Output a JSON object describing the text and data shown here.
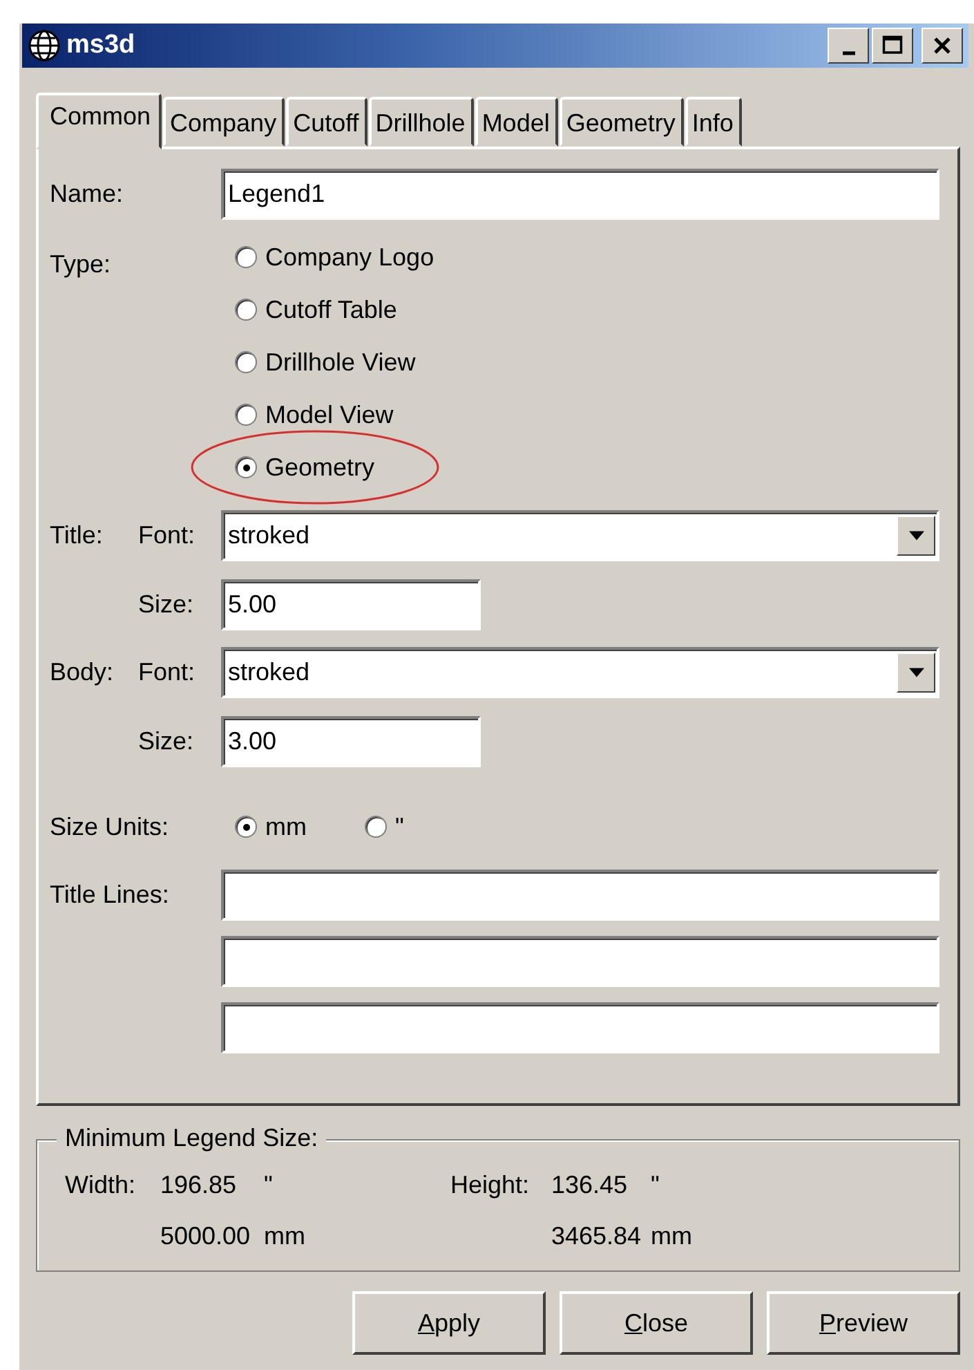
{
  "window": {
    "title": "ms3d"
  },
  "tabs": [
    {
      "label": "Common",
      "selected": true
    },
    {
      "label": "Company",
      "selected": false
    },
    {
      "label": "Cutoff",
      "selected": false
    },
    {
      "label": "Drillhole",
      "selected": false
    },
    {
      "label": "Model",
      "selected": false
    },
    {
      "label": "Geometry",
      "selected": false
    },
    {
      "label": "Info",
      "selected": false
    }
  ],
  "name": {
    "label": "Name:",
    "value": "Legend1"
  },
  "type": {
    "label": "Type:",
    "options": [
      {
        "label": "Company Logo",
        "selected": false,
        "circled": false
      },
      {
        "label": "Cutoff Table",
        "selected": false,
        "circled": false
      },
      {
        "label": "Drillhole View",
        "selected": false,
        "circled": false
      },
      {
        "label": "Model View",
        "selected": false,
        "circled": false
      },
      {
        "label": "Geometry",
        "selected": true,
        "circled": true
      }
    ]
  },
  "title_font": {
    "label": "Title:",
    "font_label": "Font:",
    "font": "stroked",
    "size_label": "Size:",
    "size": "5.00"
  },
  "body_font": {
    "label": "Body:",
    "font_label": "Font:",
    "font": "stroked",
    "size_label": "Size:",
    "size": "3.00"
  },
  "size_units": {
    "label": "Size Units:",
    "options": [
      {
        "label": "mm",
        "selected": true
      },
      {
        "label": "\"",
        "selected": false
      }
    ]
  },
  "title_lines": {
    "label": "Title Lines:"
  },
  "minimum_legend_size": {
    "label": "Minimum Legend Size:",
    "width_label": "Width:",
    "width_in": "196.85",
    "width_in_unit": "\"",
    "width_mm": "5000.00",
    "width_mm_unit": "mm",
    "height_label": "Height:",
    "height_in": "136.45",
    "height_in_unit": "\"",
    "height_mm": "3465.84",
    "height_mm_unit": "mm"
  },
  "buttons": [
    "Apply",
    "Close",
    "Preview"
  ]
}
